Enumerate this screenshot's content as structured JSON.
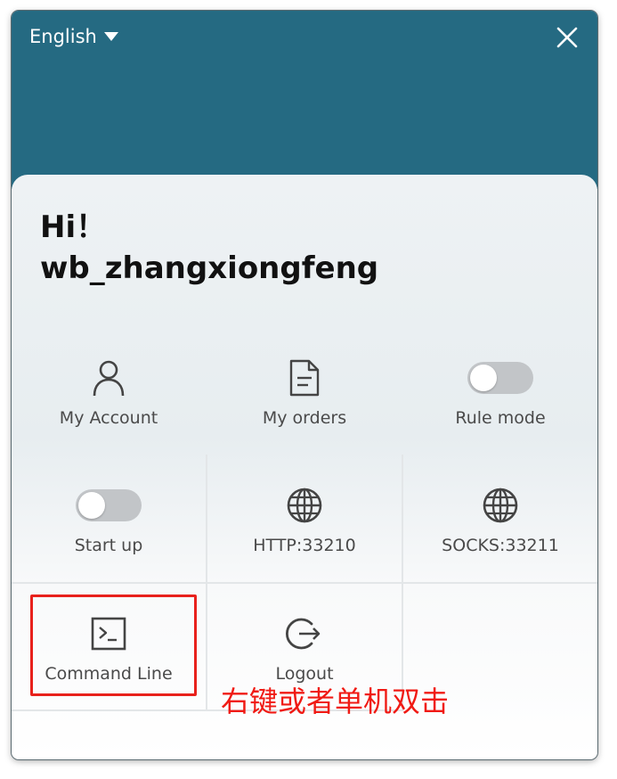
{
  "header": {
    "language": "English",
    "icons": {
      "language_caret": "caret-down-icon",
      "close": "close-icon"
    },
    "background_color": "#256a82"
  },
  "greeting": {
    "line1": "Hi！",
    "line2": "wb_zhangxiongfeng"
  },
  "grid": {
    "items": [
      {
        "label": "My Account",
        "icon": "user-icon"
      },
      {
        "label": "My orders",
        "icon": "document-icon"
      },
      {
        "label": "Rule mode",
        "icon": "toggle-off",
        "state": "off"
      },
      {
        "label": "Start up",
        "icon": "toggle-off",
        "state": "off"
      },
      {
        "label": "HTTP:33210",
        "icon": "globe-icon"
      },
      {
        "label": "SOCKS:33211",
        "icon": "globe-icon"
      },
      {
        "label": "Command Line",
        "icon": "terminal-icon"
      },
      {
        "label": "Logout",
        "icon": "logout-icon"
      }
    ]
  },
  "annotation": {
    "text": "右键或者单机双击",
    "color": "#f01a14",
    "highlight_target": "Command Line"
  }
}
